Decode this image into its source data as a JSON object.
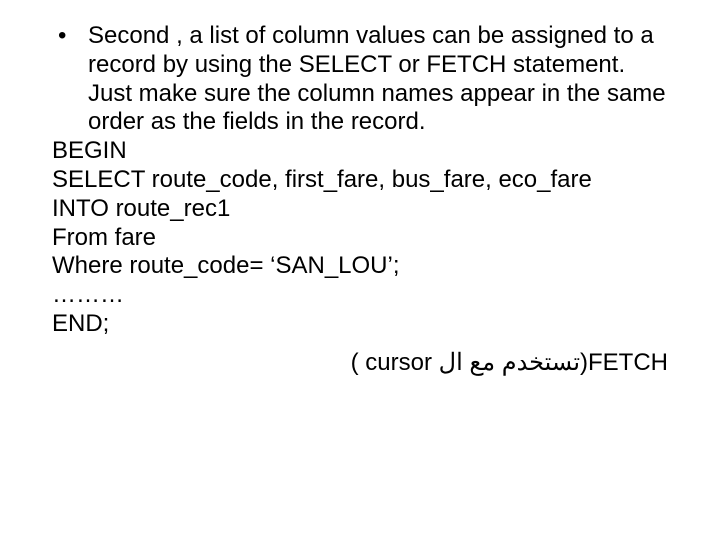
{
  "bullet": {
    "marker": "•",
    "text": "Second , a list of column values can be assigned to a record by using the SELECT or FETCH statement. Just make sure the column names appear in the same order as the fields in the record."
  },
  "code": {
    "l1": "BEGIN",
    "l2": "SELECT route_code, first_fare, bus_fare, eco_fare",
    "l3": "INTO route_rec1",
    "l4": "From fare",
    "l5": "Where route_code= ‘SAN_LOU’;",
    "l6": "………",
    "l7": "END;"
  },
  "footer": {
    "left": "( cursor ",
    "mid_rtl": "تستخدم مع ال",
    "right": ")FETCH"
  }
}
